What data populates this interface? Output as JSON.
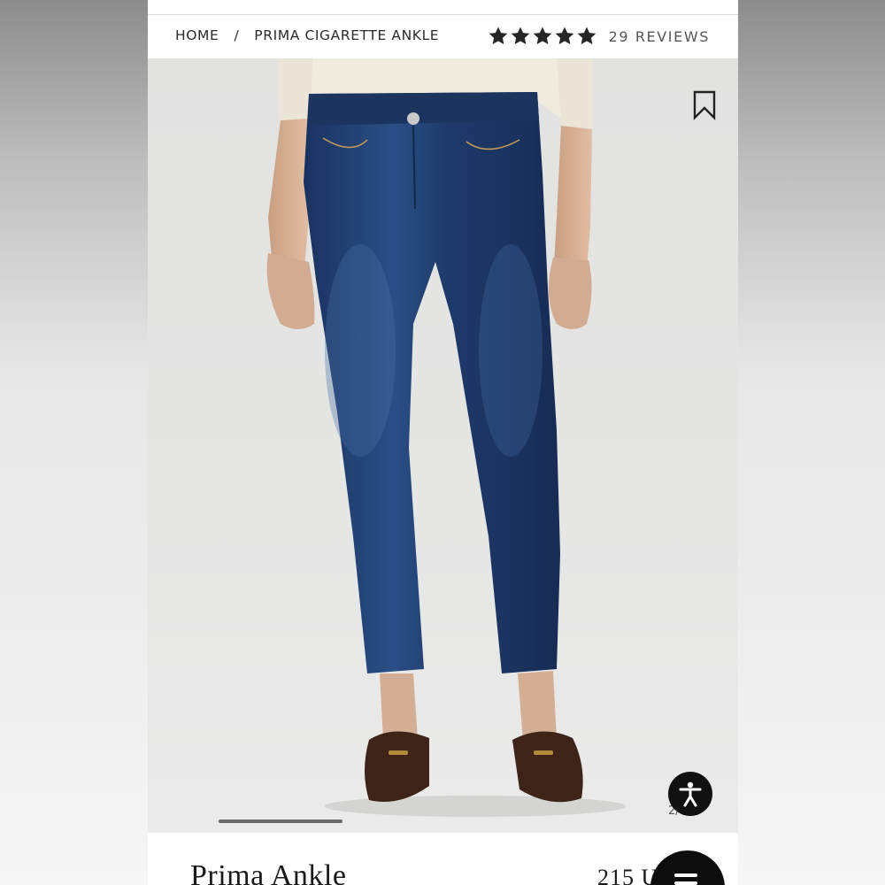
{
  "breadcrumb": {
    "home": "HOME",
    "separator": "/",
    "current": "PRIMA CIGARETTE ANKLE"
  },
  "rating": {
    "stars": 5,
    "reviews_label": "29 REVIEWS"
  },
  "gallery": {
    "slide_counter": "2/"
  },
  "product": {
    "title": "Prima Ankle",
    "price": "215 U"
  },
  "colors": {
    "denim": "#1f3b6b",
    "sweater": "#f1ece0",
    "loafer": "#3d2318",
    "skin": "#d8b49a"
  },
  "icons": [
    "star-icon",
    "bookmark-icon",
    "accessibility-icon",
    "chat-icon"
  ]
}
